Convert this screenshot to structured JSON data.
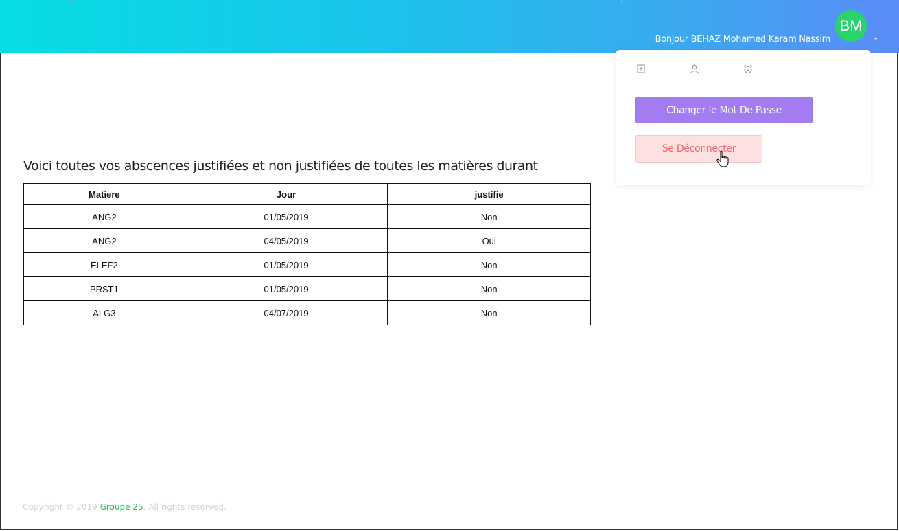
{
  "header": {
    "greeting": "Bonjour BEHAZ Mohamed Karam Nassim",
    "avatar_initials": "BM",
    "avatar_color": "#2bd36d",
    "chevron": "⌄"
  },
  "dropdown": {
    "icons": [
      "bookmark-plus-icon",
      "user-icon",
      "alarm-clock-icon"
    ],
    "change_password_label": "Changer le Mot De Passe",
    "logout_label": "Se Déconnecter"
  },
  "main": {
    "heading": "Voici toutes vos abscences justifiées et non justifiées de toutes les matières durant",
    "table": {
      "headers": [
        "Matiere",
        "Jour",
        "justifie"
      ],
      "rows": [
        [
          "ANG2",
          "01/05/2019",
          "Non"
        ],
        [
          "ANG2",
          "04/05/2019",
          "Oui"
        ],
        [
          "ELEF2",
          "01/05/2019",
          "Non"
        ],
        [
          "PRST1",
          "01/05/2019",
          "Non"
        ],
        [
          "ALG3",
          "04/07/2019",
          "Non"
        ]
      ]
    }
  },
  "footer": {
    "prefix": "Copyright © 2019 ",
    "brand": "Groupe 25",
    "suffix": ". All rights reserved."
  }
}
